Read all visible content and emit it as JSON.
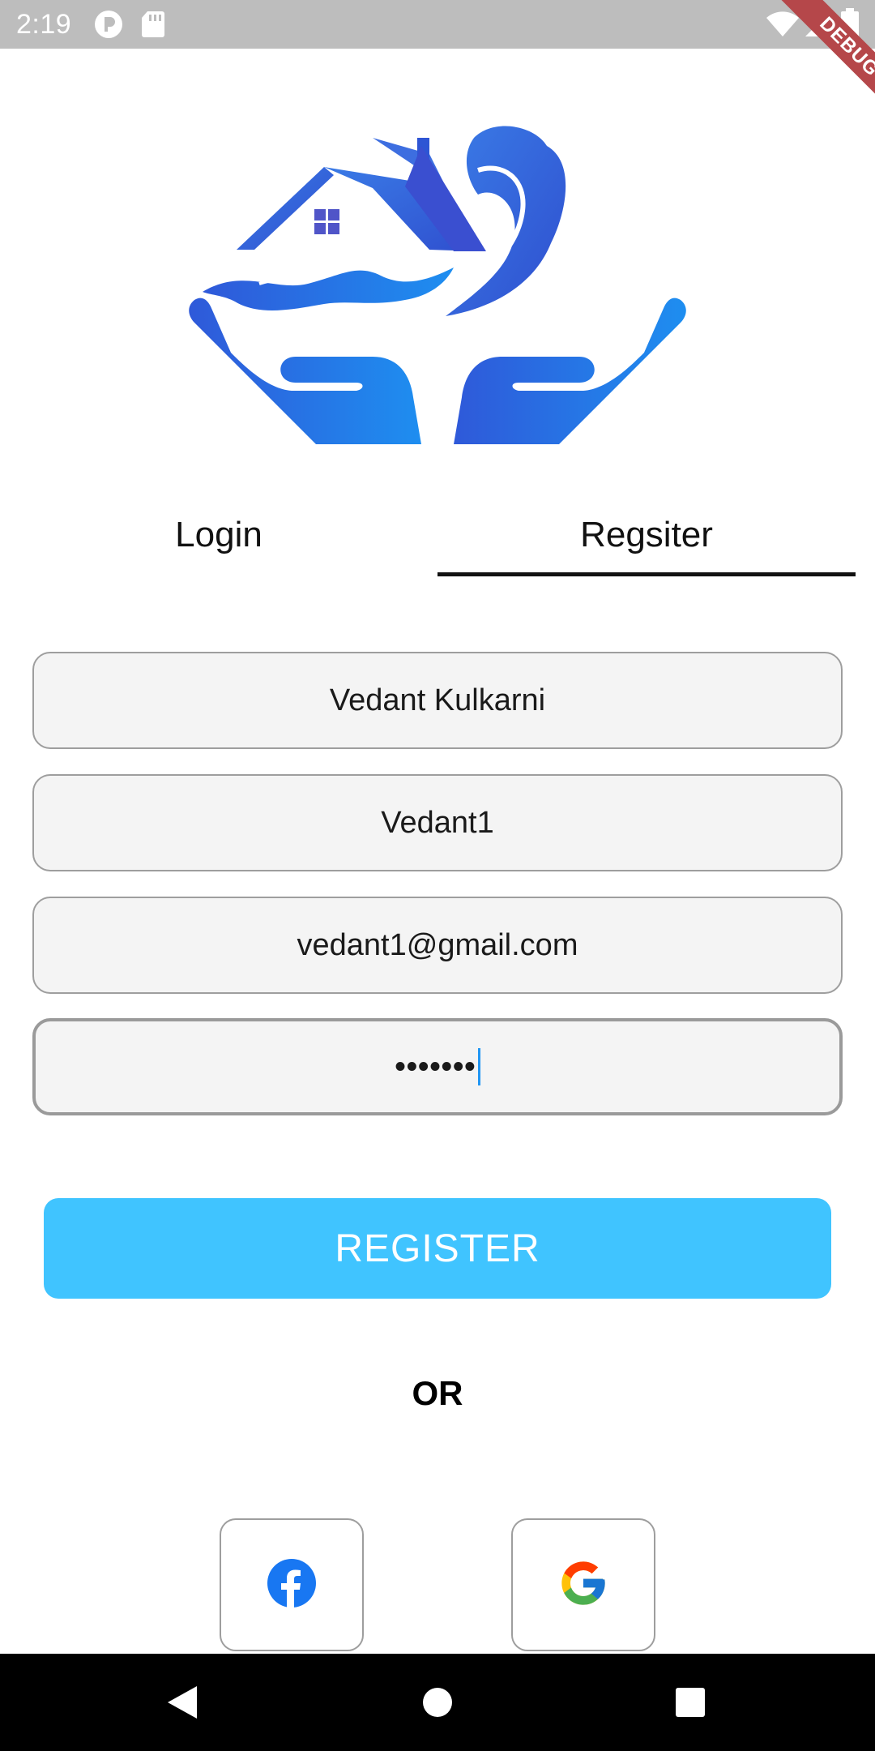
{
  "status_bar": {
    "time": "2:19",
    "icons": [
      "p-app-icon",
      "sd-card-icon",
      "wifi-icon",
      "signal-icon",
      "battery-icon"
    ],
    "debug_label": "DEBUG"
  },
  "logo": {
    "icon": "home-insurance-logo",
    "colors": [
      "#2f59d9",
      "#3a7be6",
      "#1e8ef0"
    ]
  },
  "tabs": [
    {
      "label": "Login",
      "selected": false
    },
    {
      "label": "Regsiter",
      "selected": true
    }
  ],
  "form": {
    "full_name": "Vedant Kulkarni",
    "username": "Vedant1",
    "email": "vedant1@gmail.com",
    "password_masked": "•••••••"
  },
  "register_button": {
    "label": "REGISTER",
    "color": "#40c4ff"
  },
  "divider_text": "OR",
  "social": [
    {
      "icon": "facebook-icon",
      "color": "#1877f2"
    },
    {
      "icon": "google-icon"
    }
  ],
  "nav": [
    "back-icon",
    "home-icon",
    "recents-icon"
  ]
}
